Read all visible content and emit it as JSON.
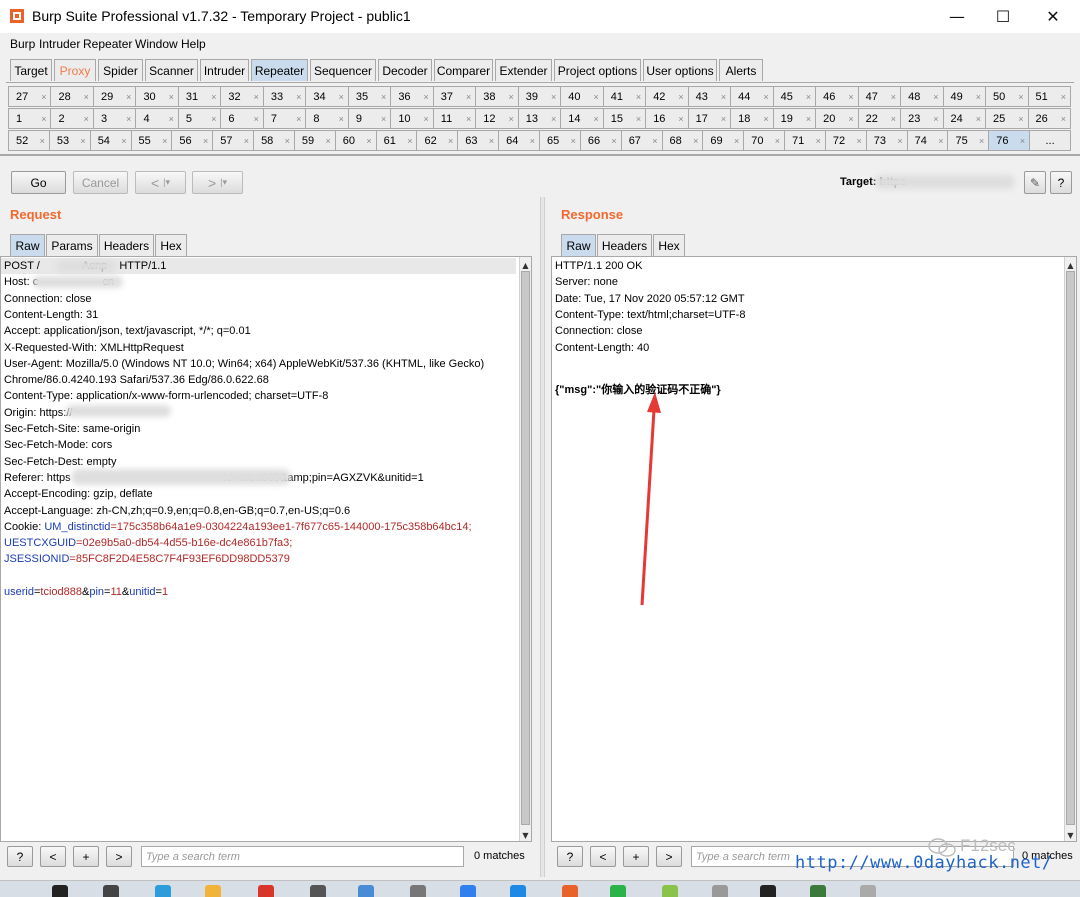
{
  "window": {
    "title": "Burp Suite Professional v1.7.32 - Temporary Project - public1",
    "minimize": "—",
    "maximize": "☐",
    "close": "✕"
  },
  "menu": [
    "Burp",
    "Intruder",
    "Repeater",
    "Window",
    "Help"
  ],
  "main_tabs": [
    "Target",
    "Proxy",
    "Spider",
    "Scanner",
    "Intruder",
    "Repeater",
    "Sequencer",
    "Decoder",
    "Comparer",
    "Extender",
    "Project options",
    "User options",
    "Alerts"
  ],
  "main_tab_active": "Repeater",
  "repeater_tabs": {
    "row1": [
      "27",
      "28",
      "29",
      "30",
      "31",
      "32",
      "33",
      "34",
      "35",
      "36",
      "37",
      "38",
      "39",
      "40",
      "41",
      "42",
      "43",
      "44",
      "45",
      "46",
      "47",
      "48",
      "49",
      "50",
      "51"
    ],
    "row2": [
      "1",
      "2",
      "3",
      "4",
      "5",
      "6",
      "7",
      "8",
      "9",
      "10",
      "11",
      "12",
      "13",
      "14",
      "15",
      "16",
      "17",
      "18",
      "19",
      "20",
      "22",
      "23",
      "24",
      "25",
      "26"
    ],
    "row3": [
      "52",
      "53",
      "54",
      "55",
      "56",
      "57",
      "58",
      "59",
      "60",
      "61",
      "62",
      "63",
      "64",
      "65",
      "66",
      "67",
      "68",
      "69",
      "70",
      "71",
      "72",
      "73",
      "74",
      "75",
      "76",
      "..."
    ],
    "active": "76",
    "close_glyph": "×"
  },
  "toolbar": {
    "go": "Go",
    "cancel": "Cancel",
    "back": "<",
    "back_menu": "|▾",
    "forward": ">",
    "forward_menu": "|▾",
    "target_label": "Target: https",
    "target_value": "://",
    "edit_icon": "✎",
    "help": "?"
  },
  "request": {
    "title": "Request",
    "tabs": [
      "Raw",
      "Params",
      "Headers",
      "Hex"
    ],
    "active_tab": "Raw",
    "lines": [
      {
        "segments": [
          {
            "text": "POST /",
            "color": "black"
          },
          {
            "text": "              Acnp    HTTP/1.1",
            "color": "black"
          }
        ]
      },
      {
        "segments": [
          {
            "text": "Host: ",
            "color": "black"
          },
          {
            "text": "c                     cn",
            "color": "black"
          }
        ]
      },
      {
        "segments": [
          {
            "text": "Connection: close",
            "color": "black"
          }
        ]
      },
      {
        "segments": [
          {
            "text": "Content-Length: 31",
            "color": "black"
          }
        ]
      },
      {
        "segments": [
          {
            "text": "Accept: application/json, text/javascript, */*; q=0.01",
            "color": "black"
          }
        ]
      },
      {
        "segments": [
          {
            "text": "X-Requested-With: XMLHttpRequest",
            "color": "black"
          }
        ]
      },
      {
        "segments": [
          {
            "text": "User-Agent: Mozilla/5.0 (Windows NT 10.0; Win64; x64) AppleWebKit/537.36 (KHTML, like Gecko)",
            "color": "black"
          }
        ]
      },
      {
        "segments": [
          {
            "text": "Chrome/86.0.4240.193 Safari/537.36 Edg/86.0.622.68",
            "color": "black"
          }
        ]
      },
      {
        "segments": [
          {
            "text": "Content-Type: application/x-www-form-urlencoded; charset=UTF-8",
            "color": "black"
          }
        ]
      },
      {
        "segments": [
          {
            "text": "Origin: https://",
            "color": "black"
          }
        ]
      },
      {
        "segments": [
          {
            "text": "Sec-Fetch-Site: same-origin",
            "color": "black"
          }
        ]
      },
      {
        "segments": [
          {
            "text": "Sec-Fetch-Mode: cors",
            "color": "black"
          }
        ]
      },
      {
        "segments": [
          {
            "text": "Sec-Fetch-Dest: empty",
            "color": "black"
          }
        ]
      },
      {
        "segments": [
          {
            "text": "Referer: https",
            "color": "black"
          },
          {
            "text": "                                                  id=tciod888&amp;pin=AGXZVK&unitid=1",
            "color": "black"
          }
        ]
      },
      {
        "segments": [
          {
            "text": "Accept-Encoding: gzip, deflate",
            "color": "black"
          }
        ]
      },
      {
        "segments": [
          {
            "text": "Accept-Language: zh-CN,zh;q=0.9,en;q=0.8,en-GB;q=0.7,en-US;q=0.6",
            "color": "black"
          }
        ]
      },
      {
        "segments": [
          {
            "text": "Cookie: ",
            "color": "black"
          },
          {
            "text": "UM_distinctid",
            "color": "blue"
          },
          {
            "text": "=175c358b64a1e9-0304224a193ee1-7f677c65-144000-175c358b64bc14;",
            "color": "red"
          }
        ]
      },
      {
        "segments": [
          {
            "text": "UESTCXGUID",
            "color": "blue"
          },
          {
            "text": "=02e9b5a0-db54-4d55-b16e-dc4e861b7fa3;",
            "color": "red"
          }
        ]
      },
      {
        "segments": [
          {
            "text": "JSESSIONID",
            "color": "blue"
          },
          {
            "text": "=85FC8F2D4E58C7F4F93EF6DD98DD5379",
            "color": "red"
          }
        ]
      },
      {
        "segments": [
          {
            "text": "",
            "color": "black"
          }
        ]
      },
      {
        "segments": [
          {
            "text": "userid",
            "color": "blue"
          },
          {
            "text": "=",
            "color": "black"
          },
          {
            "text": "tciod888",
            "color": "red"
          },
          {
            "text": "&",
            "color": "black"
          },
          {
            "text": "pin",
            "color": "blue"
          },
          {
            "text": "=",
            "color": "black"
          },
          {
            "text": "11",
            "color": "red"
          },
          {
            "text": "&",
            "color": "black"
          },
          {
            "text": "unitid",
            "color": "blue"
          },
          {
            "text": "=",
            "color": "black"
          },
          {
            "text": "1",
            "color": "red"
          }
        ]
      }
    ],
    "search_placeholder": "Type a search term",
    "matches": "0 matches"
  },
  "response": {
    "title": "Response",
    "tabs": [
      "Raw",
      "Headers",
      "Hex"
    ],
    "active_tab": "Raw",
    "lines": [
      "HTTP/1.1 200 OK",
      "Server: none",
      "Date: Tue, 17 Nov 2020 05:57:12 GMT",
      "Content-Type: text/html;charset=UTF-8",
      "Connection: close",
      "Content-Length: 40",
      "",
      "{\"msg\":\"你输入的验证码不正确\"}"
    ],
    "search_placeholder": "Type a search term",
    "matches": "0 matches"
  },
  "search_buttons": [
    "?",
    "<",
    "+",
    ">"
  ],
  "watermark": {
    "url": "http://www.0dayhack.net/",
    "brand": "F12sec"
  },
  "colors": {
    "accent_orange": "#f06a30",
    "active_tab": "#c9dbec",
    "key_blue": "#1a3bb4",
    "value_red": "#b32828",
    "annotation_arrow": "#e53935"
  }
}
